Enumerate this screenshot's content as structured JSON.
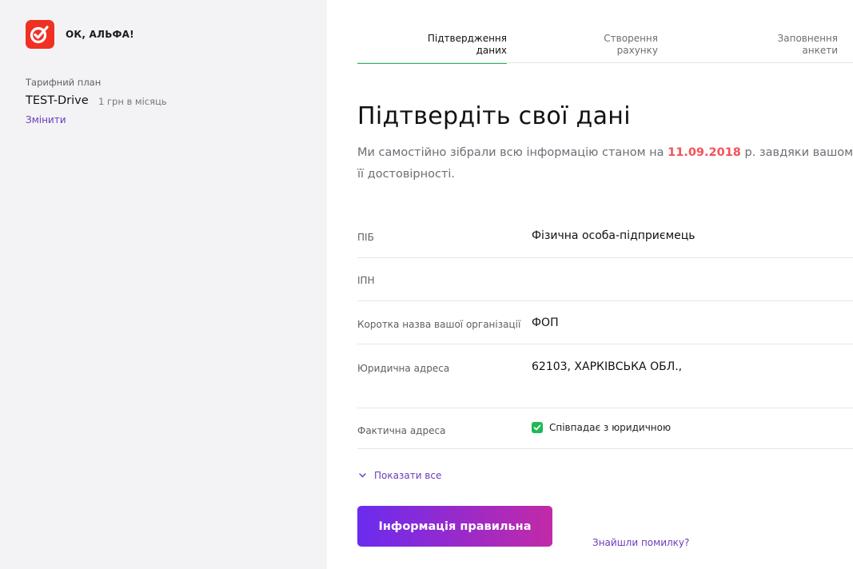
{
  "sidebar": {
    "brand": "ОК, АЛЬФА!",
    "plan_caption": "Тарифний план",
    "plan_name": "TEST-Drive",
    "plan_price": "1 грн в місяць",
    "change_link": "Змінити"
  },
  "steps": [
    {
      "line1": "Підтвердження",
      "line2": "даних",
      "active": true
    },
    {
      "line1": "Створення",
      "line2": "рахунку",
      "active": false
    },
    {
      "line1": "Заповнення",
      "line2": "анкети",
      "active": false
    }
  ],
  "main": {
    "title": "Підтвердіть свої дані",
    "intro_before": "Ми самостійно зібрали всю інформацію станом на ",
    "intro_date": "11.09.2018",
    "intro_after": " р. завдяки вашому ІП",
    "intro_line2": "її достовірності."
  },
  "fields": {
    "pib_label": "ПІБ",
    "pib_value": "Фізична особа-підприємець",
    "ipn_label": "ІПН",
    "org_label": "Коротка назва вашої організації",
    "org_value": "ФОП",
    "legal_label": "Юридична адреса",
    "legal_value": "62103, ХАРКІВСЬКА ОБЛ.,",
    "actual_label": "Фактична адреса",
    "same_as_legal": "Співпадає з юридичною",
    "same_as_legal_checked": true
  },
  "actions": {
    "show_all": "Показати все",
    "submit": "Інформація правильна",
    "found_error": "Знайшли помилку?"
  },
  "colors": {
    "brand_red": "#ef3124",
    "accent_green": "#1db954",
    "link_purple": "#6b3aba",
    "date_red": "#f2535a"
  }
}
